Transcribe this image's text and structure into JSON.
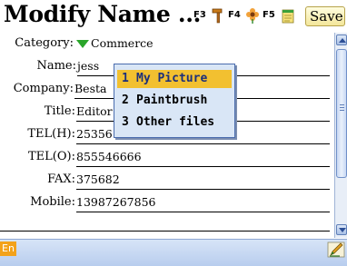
{
  "header": {
    "title": "Modify Name ...",
    "f3": "F3",
    "f4": "F4",
    "f5": "F5",
    "save_label": "Save"
  },
  "form": {
    "fields": [
      {
        "label": "Category:",
        "value": "Commerce"
      },
      {
        "label": "Name:",
        "value": "jess"
      },
      {
        "label": "Company:",
        "value": "Besta"
      },
      {
        "label": "Title:",
        "value": "Editor"
      },
      {
        "label": "TEL(H):",
        "value": "25356"
      },
      {
        "label": "TEL(O):",
        "value": "855546666"
      },
      {
        "label": "FAX:",
        "value": "375682"
      },
      {
        "label": "Mobile:",
        "value": "13987267856"
      }
    ]
  },
  "popup": {
    "items": [
      {
        "num": "1",
        "label": "My Picture",
        "selected": true
      },
      {
        "num": "2",
        "label": "Paintbrush",
        "selected": false
      },
      {
        "num": "3",
        "label": "Other files",
        "selected": false
      }
    ]
  },
  "status": {
    "input_mode": "En"
  },
  "colors": {
    "accent": "#f2c030",
    "popup_bg": "#d9e6f6",
    "bar_bg": "#c6d8f2",
    "category_marker": "#2aa52a"
  },
  "icons": [
    "hammer-icon",
    "flower-icon",
    "notepad-icon",
    "pen-icon"
  ]
}
